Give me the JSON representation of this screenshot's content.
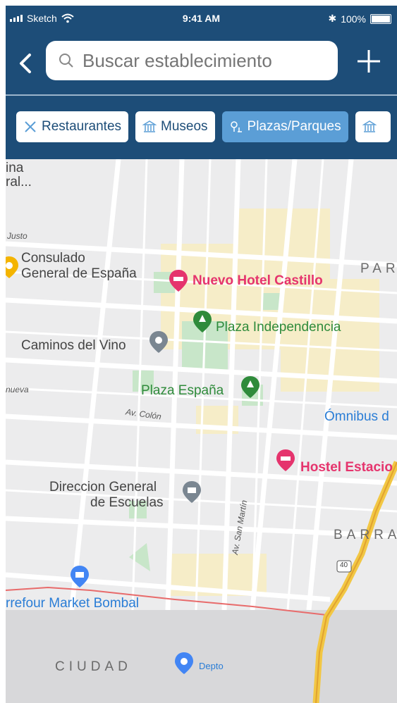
{
  "status_bar": {
    "carrier": "Sketch",
    "time": "9:41 AM",
    "battery": "100%"
  },
  "header": {
    "search_placeholder": "Buscar establecimiento",
    "chips": [
      {
        "label": "Restaurantes",
        "icon": "utensils-icon",
        "active": false
      },
      {
        "label": "Museos",
        "icon": "museum-icon",
        "active": false
      },
      {
        "label": "Plazas/Parques",
        "icon": "park-icon",
        "active": true
      }
    ]
  },
  "map": {
    "labels": {
      "consulado_line1": "Consulado",
      "consulado_line2": "General de España",
      "hotel": "Nuevo Hotel Castillo",
      "plaza_independencia": "Plaza Independencia",
      "caminos": "Caminos del Vino",
      "plaza_espana": "Plaza España",
      "av_colon": "Av. Colón",
      "omnibus": "Ómnibus d",
      "hostel": "Hostel Estacio",
      "direccion_line1": "Direccion General",
      "direccion_line2": "de Escuelas",
      "barrio": "BARRA",
      "route": "40",
      "market": "rrefour Market Bombal",
      "san_martin": "Av. San Martín",
      "ciudad": "CIUDAD",
      "depto": "Depto",
      "parque_cut": "PAR",
      "edge_ina": "ina",
      "edge_ral": "ral...",
      "edge_justo": "Justo",
      "edge_nueva": "nueva"
    }
  },
  "colors": {
    "header_bg": "#1d4d78",
    "chip_active": "#5b9ed6",
    "park_green": "#2f8b3b",
    "hotel_pink": "#e5346d",
    "blue": "#2a7dd6"
  }
}
